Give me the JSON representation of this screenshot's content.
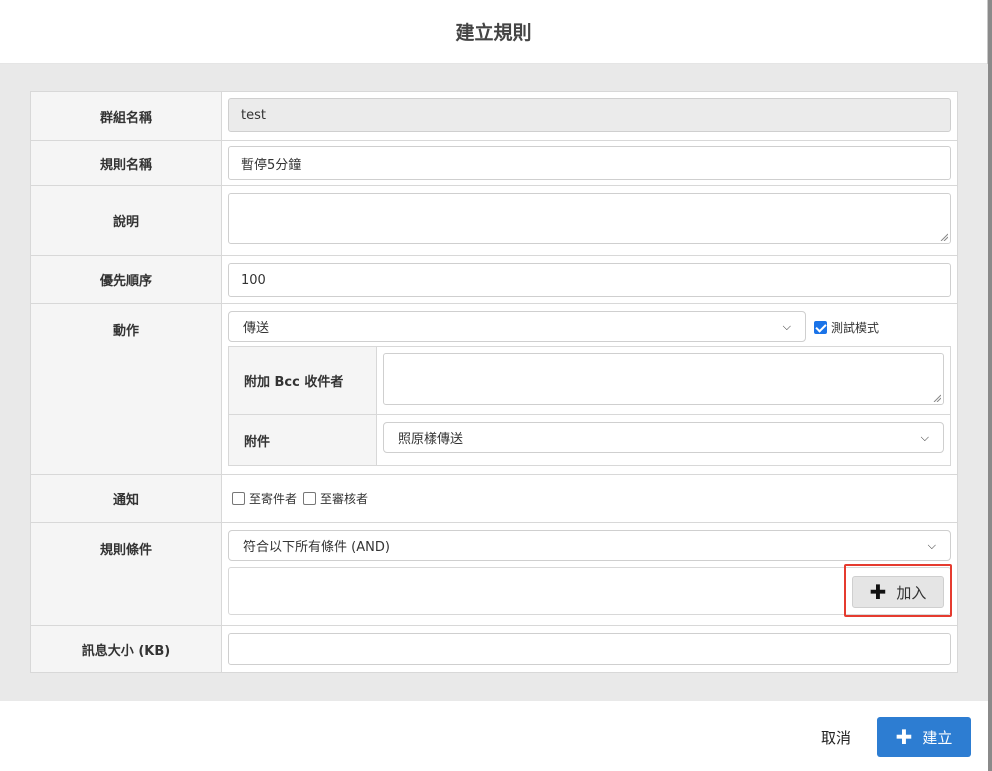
{
  "dialog": {
    "title": "建立規則"
  },
  "form": {
    "group_name": {
      "label": "群組名稱",
      "value": "test"
    },
    "rule_name": {
      "label": "規則名稱",
      "value": "暫停5分鐘"
    },
    "description": {
      "label": "說明",
      "value": ""
    },
    "priority": {
      "label": "優先順序",
      "value": "100"
    },
    "action": {
      "label": "動作",
      "selected": "傳送",
      "test_mode": {
        "label": "測試模式",
        "checked": true
      },
      "bcc": {
        "label": "附加 Bcc 收件者",
        "value": ""
      },
      "attachment": {
        "label": "附件",
        "selected": "照原樣傳送"
      }
    },
    "notify": {
      "label": "通知",
      "to_sender": {
        "label": "至寄件者",
        "checked": false
      },
      "to_reviewer": {
        "label": "至審核者",
        "checked": false
      }
    },
    "conditions": {
      "label": "規則條件",
      "selected": "符合以下所有條件 (AND)",
      "add_button": "加入"
    },
    "size": {
      "label": "訊息大小 (KB)",
      "value": ""
    }
  },
  "footer": {
    "cancel_label": "取消",
    "create_label": "建立"
  },
  "colors": {
    "primary": "#2d7dd2",
    "highlight": "#e53b2f",
    "checkbox": "#1a73e8"
  },
  "icons": {
    "add": "plus-icon",
    "dropdown": "chevron-down-icon",
    "resize": "resize-grip-icon"
  }
}
